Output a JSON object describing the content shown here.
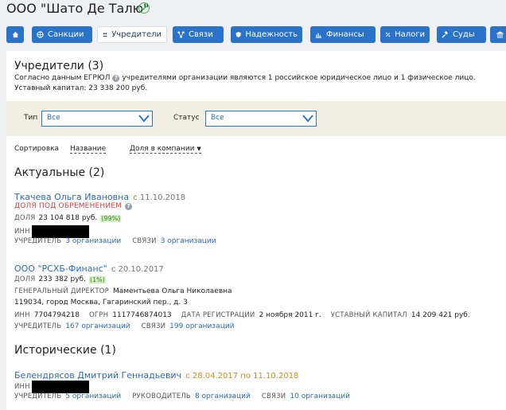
{
  "header": {
    "company_title": "ООО \"Шато Де Талю\""
  },
  "tabs": [
    {
      "label": "",
      "icon": "home-icon"
    },
    {
      "label": "Санкции",
      "icon": "globe-icon"
    },
    {
      "label": "Учредители",
      "icon": "users-icon"
    },
    {
      "label": "Связи",
      "icon": "network-icon"
    },
    {
      "label": "Надежность",
      "icon": "shield-icon"
    },
    {
      "label": "Финансы",
      "icon": "chart-icon"
    },
    {
      "label": "Налоги",
      "icon": "percent-icon"
    },
    {
      "label": "Суды",
      "icon": "gavel-icon"
    },
    {
      "label": "",
      "icon": "bank-icon"
    }
  ],
  "founders": {
    "heading": "Учредители (3)",
    "desc_before": "Согласно данным ЕГРЮЛ",
    "desc_after": "учредителями организации являются 1 российское юридическое лицо и 1 физическое лицо.",
    "capital": "Уставный капитал: 23 338 200 руб."
  },
  "filters": {
    "type_label": "Тип",
    "type_value": "Все",
    "status_label": "Статус",
    "status_value": "Все"
  },
  "sort": {
    "label": "Сортировка",
    "by_name": "Название",
    "by_share": "Доля в компании"
  },
  "actual": {
    "heading": "Актуальные (2)",
    "person1": {
      "name": "Ткачева Ольга Ивановна",
      "since": "с 11.10.2018",
      "encumbrance": "ДОЛЯ ПОД ОБРЕМЕНЕНИЕМ",
      "share_label": "ДОЛЯ",
      "share_value": "23 104 818 руб.",
      "share_pct": "(99%)",
      "inn_label": "ИНН",
      "founder_label": "УЧРЕДИТЕЛЬ",
      "founder_link": "3 организации",
      "links_label": "СВЯЗИ",
      "links_link": "3 организации"
    },
    "company": {
      "name": "ООО \"РСХБ-Финанс\"",
      "since": "с 20.10.2017",
      "share_label": "ДОЛЯ",
      "share_value": "233 382 руб.",
      "share_pct": "(1%)",
      "director_label": "ГЕНЕРАЛЬНЫЙ ДИРЕКТОР",
      "director_value": "Маментьева Ольга Николаевна",
      "address": "119034, город Москва, Гагаринский пер., д. 3",
      "inn_label": "ИНН",
      "inn_value": "7704794218",
      "ogrn_label": "ОГРН",
      "ogrn_value": "1117746874013",
      "reg_label": "ДАТА РЕГИСТРАЦИИ",
      "reg_value": "2 ноября 2011 г.",
      "capital_label": "УСТАВНЫЙ КАПИТАЛ",
      "capital_value": "14 209 421 руб.",
      "founder_label": "УЧРЕДИТЕЛЬ",
      "founder_link": "167 организаций",
      "links_label": "СВЯЗИ",
      "links_link": "199 организаций"
    }
  },
  "historical": {
    "heading": "Исторические (1)",
    "person": {
      "name": "Белендрясов Дмитрий Геннадьевич",
      "period": "с 28.04.2017 по 11.10.2018",
      "inn_label": "ИНН",
      "founder_label": "УЧРЕДИТЕЛЬ",
      "founder_link": "5 организаций",
      "head_label": "РУКОВОДИТЕЛЬ",
      "head_link": "8 организаций",
      "links_label": "СВЯЗИ",
      "links_link": "10 организаций"
    }
  },
  "colors": {
    "tab_blue": "#2a73c9",
    "link_blue": "#2a6db7",
    "warning_red": "#d43d3d",
    "period_orange": "#d98a1e",
    "check_green": "#3bb44a"
  }
}
